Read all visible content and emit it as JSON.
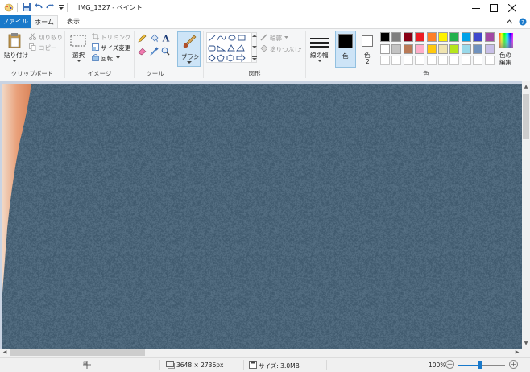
{
  "window": {
    "title": "IMG_1327 - ペイント",
    "minimize_glyph": "—",
    "maximize_glyph": "☐",
    "close_glyph": "✕"
  },
  "tabs": [
    {
      "label": "ファイル",
      "active": false
    },
    {
      "label": "ホーム",
      "active": true
    },
    {
      "label": "表示",
      "active": false
    }
  ],
  "clipboard": {
    "paste": "貼り付け",
    "cut": "切り取り",
    "copy": "コピー",
    "group": "クリップボード"
  },
  "image_group": {
    "select": "選択",
    "crop": "トリミング",
    "resize": "サイズ変更",
    "rotate": "回転",
    "group": "イメージ"
  },
  "tools": {
    "group": "ツール",
    "brushes": "ブラシ",
    "text_glyph": "A"
  },
  "shapes_group": {
    "outline": "輪郭",
    "fill": "塗りつぶし",
    "group": "図形"
  },
  "size": {
    "label": "線の幅"
  },
  "colors": {
    "color1_label": "色",
    "color1_num": "1",
    "color2_label": "色",
    "color2_num": "2",
    "edit_label_1": "色の",
    "edit_label_2": "編集",
    "group": "色",
    "color1": "#000000",
    "color2": "#ffffff",
    "palette_row1": [
      "#000000",
      "#7f7f7f",
      "#880015",
      "#ed1c24",
      "#ff7f27",
      "#fff200",
      "#22b14c",
      "#00a2e8",
      "#3f48cc",
      "#a349a4"
    ],
    "palette_row2": [
      "#ffffff",
      "#c3c3c3",
      "#b97a57",
      "#ffaec9",
      "#ffc90e",
      "#efe4b0",
      "#b5e61d",
      "#99d9ea",
      "#7092be",
      "#c8bfe7"
    ]
  },
  "status": {
    "dimensions": "3648 × 2736px",
    "size": "サイズ: 3.0MB",
    "zoom": "100%",
    "zoom_minus": "－",
    "zoom_plus": "＋",
    "zoom_slider_position": 0.45
  },
  "canvas": {
    "image_color": "#4b6579",
    "skin_color": "#e08d5e"
  }
}
